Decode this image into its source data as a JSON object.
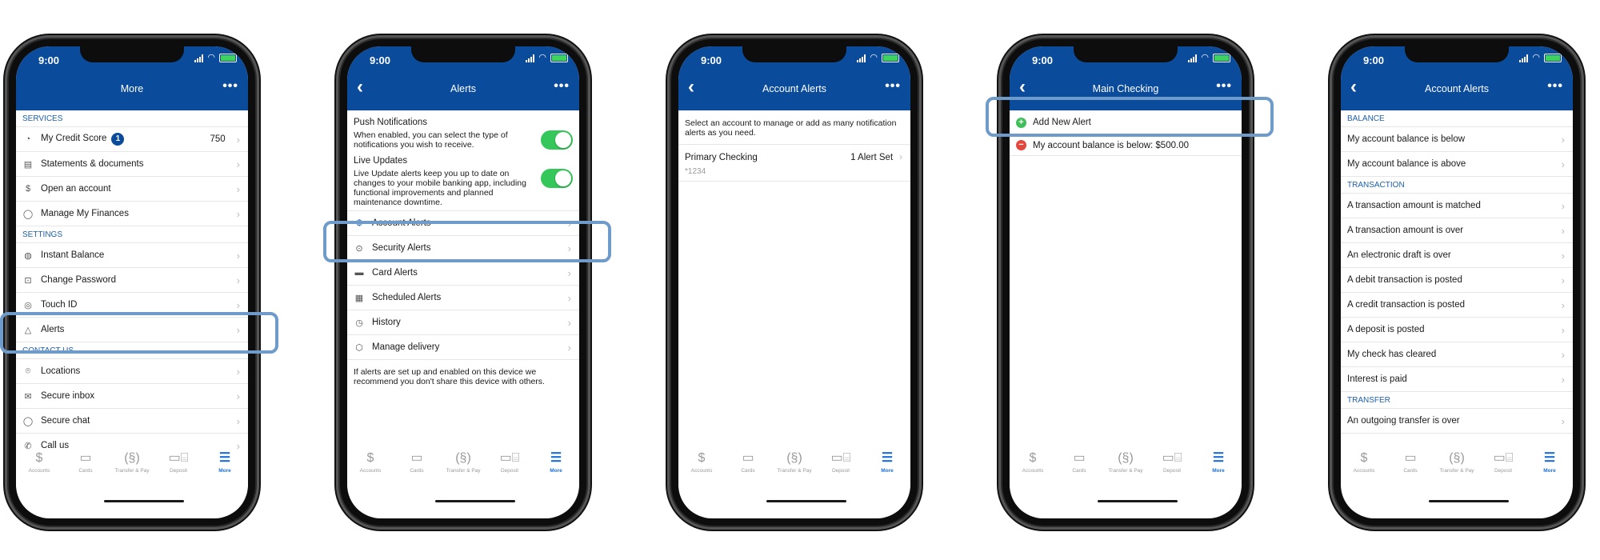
{
  "status_time": "9:00",
  "tabs": [
    {
      "icon": "dollar-icon",
      "glyph": "$",
      "label": "Accounts"
    },
    {
      "icon": "card-icon",
      "glyph": "▭",
      "label": "Cards"
    },
    {
      "icon": "transfer-icon",
      "glyph": "(§)",
      "label": "Transfer & Pay"
    },
    {
      "icon": "deposit-icon",
      "glyph": "▭⌸",
      "label": "Deposit"
    },
    {
      "icon": "more-icon",
      "glyph": "☰",
      "label": "More"
    }
  ],
  "screens": [
    {
      "title": "More",
      "rows": [
        {
          "type": "section",
          "label": "SERVICES"
        },
        {
          "label": "My Credit Score",
          "icon": "gauge-icon",
          "glyph": "◔",
          "badge": "1",
          "value": "750"
        },
        {
          "label": "Statements & documents",
          "icon": "document-icon",
          "glyph": "▤"
        },
        {
          "label": "Open an account",
          "icon": "dollar-circle-icon",
          "glyph": "$"
        },
        {
          "label": "Manage My Finances",
          "icon": "finance-icon",
          "glyph": "◯"
        },
        {
          "type": "section",
          "label": "SETTINGS"
        },
        {
          "label": "Instant Balance",
          "icon": "instant-balance-icon",
          "glyph": "◍"
        },
        {
          "label": "Change Password",
          "icon": "lock-icon",
          "glyph": "⊡"
        },
        {
          "label": "Touch ID",
          "icon": "fingerprint-icon",
          "glyph": "◎"
        },
        {
          "label": "Alerts",
          "icon": "bell-icon",
          "glyph": "△"
        },
        {
          "type": "section",
          "label": "CONTACT US"
        },
        {
          "label": "Locations",
          "icon": "location-pin-icon",
          "glyph": "⌾"
        },
        {
          "label": "Secure inbox",
          "icon": "envelope-icon",
          "glyph": "✉"
        },
        {
          "label": "Secure chat",
          "icon": "chat-bubble-icon",
          "glyph": "◯"
        },
        {
          "label": "Call us",
          "icon": "phone-icon",
          "glyph": "✆"
        }
      ]
    },
    {
      "title": "Alerts",
      "push_title": "Push Notifications",
      "push_text": "When enabled, you can select the type of notifications you wish to receive.",
      "live_title": "Live Updates",
      "live_text": "Live Update alerts keep you up to date on changes to your mobile banking app, including functional improvements and planned maintenance downtime.",
      "rows": [
        {
          "label": "Account Alerts",
          "icon": "dollar-alert-icon",
          "glyph": "$"
        },
        {
          "label": "Security Alerts",
          "icon": "security-icon",
          "glyph": "⊙"
        },
        {
          "label": "Card Alerts",
          "icon": "card-icon",
          "glyph": "▬"
        },
        {
          "label": "Scheduled Alerts",
          "icon": "calendar-icon",
          "glyph": "▦"
        },
        {
          "label": "History",
          "icon": "history-icon",
          "glyph": "◷"
        },
        {
          "label": "Manage delivery",
          "icon": "delivery-icon",
          "glyph": "⬡"
        }
      ],
      "footer": "If alerts are set up and enabled on this device we recommend you don't share this device with others."
    },
    {
      "title": "Account Alerts",
      "intro": "Select an account to manage or add as many notification alerts as you need.",
      "account_name": "Primary Checking",
      "account_alerts": "1 Alert Set",
      "account_number": "*1234"
    },
    {
      "title": "Main Checking",
      "add_label": "Add New Alert",
      "existing_alert": "My account balance is below: $500.00"
    },
    {
      "title": "Account Alerts",
      "rows": [
        {
          "type": "section",
          "label": "BALANCE"
        },
        {
          "label": "My account balance is below"
        },
        {
          "label": "My account balance is above"
        },
        {
          "type": "section",
          "label": "TRANSACTION"
        },
        {
          "label": "A transaction amount is matched"
        },
        {
          "label": "A transaction amount is over"
        },
        {
          "label": "An electronic draft is over"
        },
        {
          "label": "A debit transaction is posted"
        },
        {
          "label": "A credit transaction is posted"
        },
        {
          "label": "A deposit is posted"
        },
        {
          "label": "My check has cleared"
        },
        {
          "label": "Interest is paid"
        },
        {
          "type": "section",
          "label": "TRANSFER"
        },
        {
          "label": "An outgoing transfer is over"
        }
      ]
    }
  ],
  "colors": {
    "header": "#0a4b9c",
    "highlight": "#6f9bcb",
    "toggle_on": "#35c759",
    "add_icon": "#3fbf5a",
    "remove_icon": "#e5473d",
    "section_text": "#1d5fae"
  }
}
